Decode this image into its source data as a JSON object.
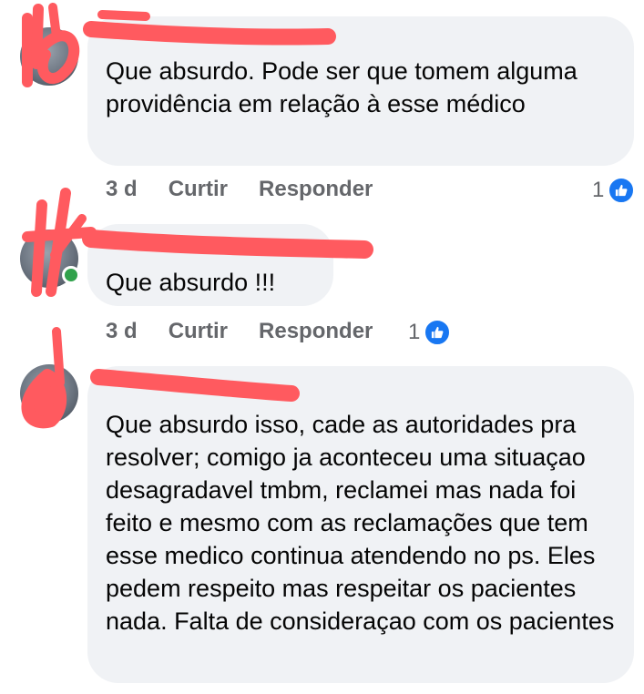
{
  "comments": [
    {
      "name": "",
      "text": "Que absurdo.  Pode ser que tomem alguma providência em relação à esse médico",
      "time": "3 d",
      "like_label": "Curtir",
      "reply_label": "Responder",
      "reaction_count": "1",
      "online": false
    },
    {
      "name": "",
      "text": "Que absurdo !!!",
      "time": "3 d",
      "like_label": "Curtir",
      "reply_label": "Responder",
      "reaction_count": "1",
      "online": true
    },
    {
      "name": "",
      "text": "Que absurdo isso, cade as autoridades pra resolver; comigo ja aconteceu uma situaçao desagradavel tmbm, reclamei mas nada foi feito e mesmo com as reclamações que tem esse medico continua atendendo no ps. Eles pedem respeito mas respeitar os pacientes nada. Falta de consideraçao com os pacientes"
    }
  ],
  "colors": {
    "bubble": "#f0f2f5",
    "meta_text": "#65676b",
    "like_blue": "#1877f2",
    "redaction": "#ff5a5f",
    "online": "#31a24c"
  },
  "icons": {
    "reaction": "thumbs-up-icon"
  }
}
